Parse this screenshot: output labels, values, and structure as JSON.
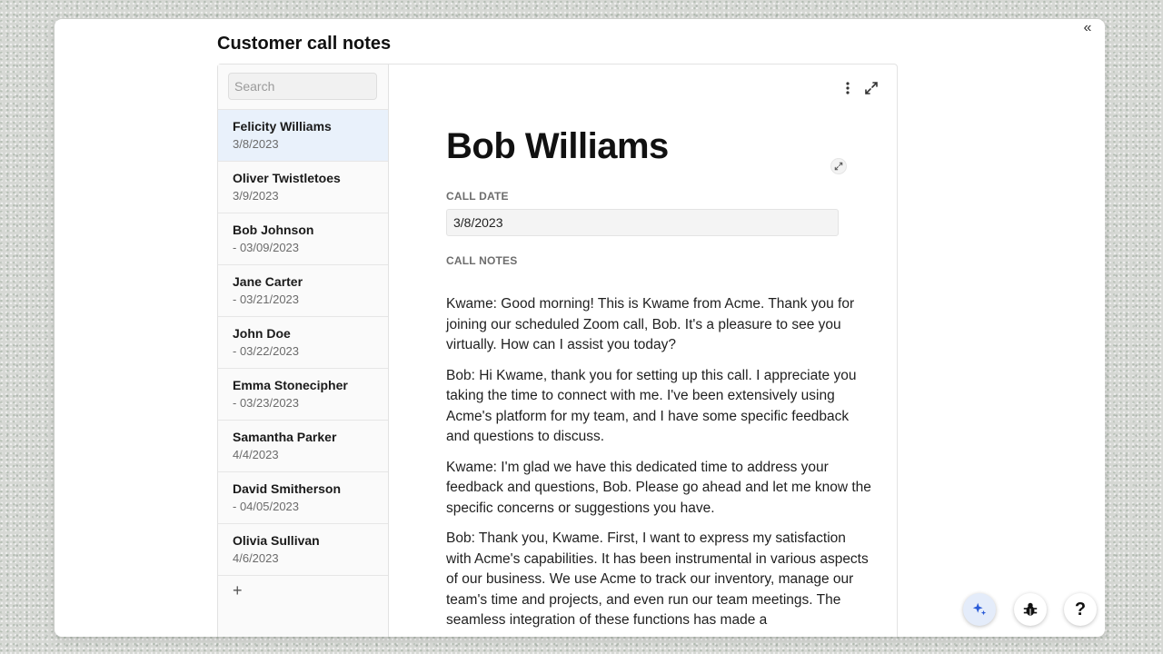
{
  "header": {
    "title": "Customer call notes"
  },
  "sidebar": {
    "search_placeholder": "Search",
    "items": [
      {
        "name": "Felicity Williams",
        "date": "3/8/2023"
      },
      {
        "name": "Oliver Twistletoes",
        "date": "3/9/2023"
      },
      {
        "name": "Bob Johnson",
        "date": "- 03/09/2023"
      },
      {
        "name": "Jane Carter",
        "date": "- 03/21/2023"
      },
      {
        "name": "John Doe",
        "date": "- 03/22/2023"
      },
      {
        "name": "Emma Stonecipher",
        "date": "- 03/23/2023"
      },
      {
        "name": "Samantha Parker",
        "date": "4/4/2023"
      },
      {
        "name": "David Smitherson",
        "date": "- 04/05/2023"
      },
      {
        "name": "Olivia Sullivan",
        "date": "4/6/2023"
      }
    ],
    "add_label": "+"
  },
  "record": {
    "title": "Bob Williams",
    "call_date_label": "CALL DATE",
    "call_date": "3/8/2023",
    "call_notes_label": "CALL NOTES",
    "notes": [
      "Kwame: Good morning! This is Kwame from Acme. Thank you for joining our scheduled Zoom call, Bob. It's a pleasure to see you virtually. How can I assist you today?",
      "Bob: Hi Kwame, thank you for setting up this call. I appreciate you taking the time to connect with me. I've been extensively using Acme's platform for my team, and I have some specific feedback and questions to discuss.",
      "Kwame: I'm glad we have this dedicated time to address your feedback and questions, Bob. Please go ahead and let me know the specific concerns or suggestions you have.",
      "Bob: Thank you, Kwame. First, I want to express my satisfaction with Acme's capabilities. It has been instrumental in various aspects of our business. We use Acme to track our inventory, manage our team's time and projects, and even run our team meetings. The seamless integration of these functions has made a"
    ]
  },
  "floating": {
    "help_label": "?"
  },
  "icons": {
    "collapse": "double-chevron-left-icon",
    "more": "more-vertical-icon",
    "expand": "expand-icon",
    "ai": "sparkle-icon",
    "bug": "bug-icon"
  }
}
